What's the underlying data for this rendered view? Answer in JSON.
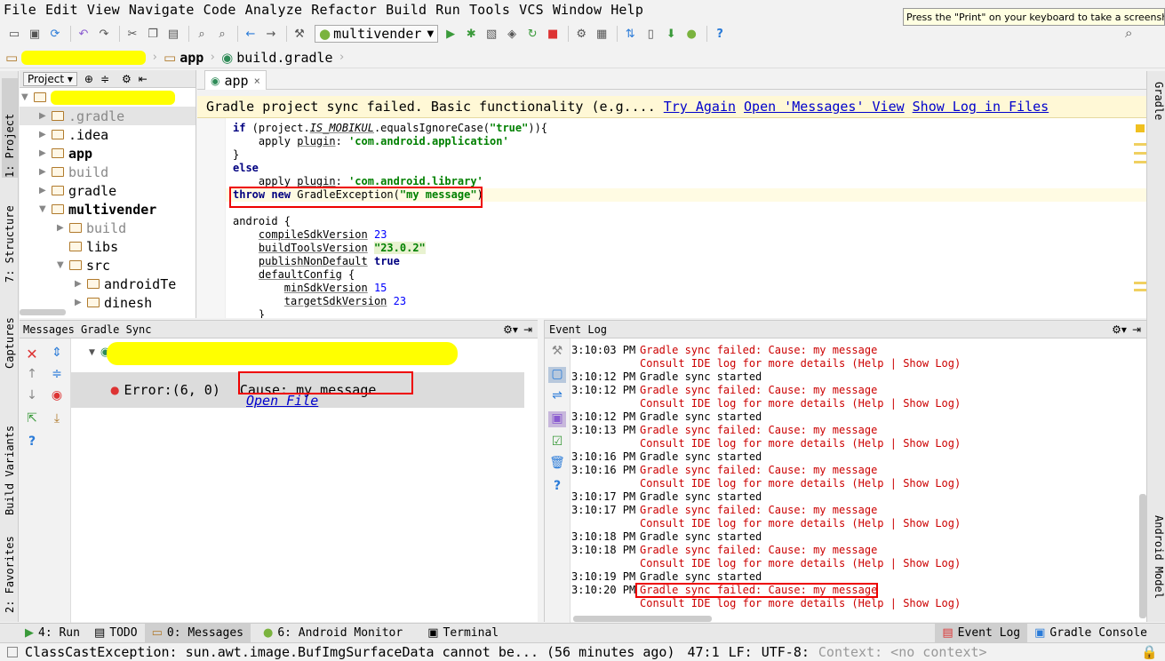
{
  "menubar": {
    "items": [
      "File",
      "Edit",
      "View",
      "Navigate",
      "Code",
      "Analyze",
      "Refactor",
      "Build",
      "Run",
      "Tools",
      "VCS",
      "Window",
      "Help"
    ]
  },
  "tooltip": "Press the \"Print\" on your keyboard to take a screenshot",
  "toolbar": {
    "run_config": "multivender",
    "help": "?"
  },
  "breadcrumb": {
    "module": "app",
    "file": "build.gradle"
  },
  "left_stripe": {
    "tabs": [
      "1: Project",
      "7: Structure",
      "Captures",
      "Build Variants",
      "2: Favorites"
    ]
  },
  "right_stripe": {
    "tabs": [
      "Gradle",
      "Android Model"
    ]
  },
  "project_panel": {
    "header": "Project",
    "tree": [
      {
        "label": ".gradle",
        "dim": true
      },
      {
        "label": ".idea",
        "dim": false
      },
      {
        "label": "app",
        "dim": false,
        "bold": true
      },
      {
        "label": "build",
        "dim": true
      },
      {
        "label": "gradle",
        "dim": false
      },
      {
        "label": "multivender",
        "dim": false,
        "bold": true
      },
      {
        "label": "build",
        "dim": true
      },
      {
        "label": "libs",
        "dim": false
      },
      {
        "label": "src",
        "dim": false
      },
      {
        "label": "androidTe",
        "dim": false
      },
      {
        "label": "dinesh",
        "dim": false
      }
    ]
  },
  "editor": {
    "tab_label": "app",
    "banner_text": "Gradle project sync failed. Basic functionality (e.g....",
    "banner_links": [
      "Try Again",
      "Open 'Messages' View",
      "Show Log in Files"
    ],
    "code": {
      "l1_kw": "if",
      "l1_a": " (project.",
      "l1_prop": "IS_MOBIKUL",
      "l1_b": ".equalsIgnoreCase(",
      "l1_str": "\"true\"",
      "l1_c": ")){",
      "l2_a": "    apply ",
      "l2_prop": "plugin",
      "l2_b": ": ",
      "l2_str": "'com.android.application'",
      "l3": "}",
      "l4_kw": "else",
      "l5_a": "    apply ",
      "l5_prop": "plugin",
      "l5_b": ": ",
      "l5_str": "'com.android.library'",
      "l6_kw1": "throw",
      "l6_kw2": "new",
      "l6_a": " GradleException(",
      "l6_str": "\"my message\"",
      "l6_b": ")",
      "l8": "android {",
      "l9_a": "    ",
      "l9_prop": "compileSdkVersion",
      "l9_num": "23",
      "l10_prop": "buildToolsVersion",
      "l10_str": "\"23.0.2\"",
      "l11_prop": "publishNonDefault",
      "l11_kw": "true",
      "l12_prop": "defaultConfig",
      "l12_b": " {",
      "l13_prop": "minSdkVersion",
      "l13_num": "15",
      "l14_prop": "targetSdkVersion",
      "l14_num": "23",
      "l15": "    }"
    }
  },
  "messages": {
    "header": "Messages Gradle Sync",
    "error_prefix": "Error:(6, 0)",
    "error_text": "Cause: my message",
    "open_file": "Open File"
  },
  "event_log": {
    "header": "Event Log",
    "rows": [
      {
        "time": "3:10:03 PM",
        "text": "Gradle sync failed: Cause: my message",
        "error": true
      },
      {
        "time": "",
        "text": "Consult IDE log for more details (Help | Show Log)",
        "error": true
      },
      {
        "time": "3:10:12 PM",
        "text": "Gradle sync started",
        "error": false
      },
      {
        "time": "3:10:12 PM",
        "text": "Gradle sync failed: Cause: my message",
        "error": true
      },
      {
        "time": "",
        "text": "Consult IDE log for more details (Help | Show Log)",
        "error": true
      },
      {
        "time": "3:10:12 PM",
        "text": "Gradle sync started",
        "error": false
      },
      {
        "time": "3:10:13 PM",
        "text": "Gradle sync failed: Cause: my message",
        "error": true
      },
      {
        "time": "",
        "text": "Consult IDE log for more details (Help | Show Log)",
        "error": true
      },
      {
        "time": "3:10:16 PM",
        "text": "Gradle sync started",
        "error": false
      },
      {
        "time": "3:10:16 PM",
        "text": "Gradle sync failed: Cause: my message",
        "error": true
      },
      {
        "time": "",
        "text": "Consult IDE log for more details (Help | Show Log)",
        "error": true
      },
      {
        "time": "3:10:17 PM",
        "text": "Gradle sync started",
        "error": false
      },
      {
        "time": "3:10:17 PM",
        "text": "Gradle sync failed: Cause: my message",
        "error": true
      },
      {
        "time": "",
        "text": "Consult IDE log for more details (Help | Show Log)",
        "error": true
      },
      {
        "time": "3:10:18 PM",
        "text": "Gradle sync started",
        "error": false
      },
      {
        "time": "3:10:18 PM",
        "text": "Gradle sync failed: Cause: my message",
        "error": true
      },
      {
        "time": "",
        "text": "Consult IDE log for more details (Help | Show Log)",
        "error": true
      },
      {
        "time": "3:10:19 PM",
        "text": "Gradle sync started",
        "error": false
      },
      {
        "time": "3:10:20 PM",
        "text": "Gradle sync failed: Cause: my message",
        "error": true
      },
      {
        "time": "",
        "text": "Consult IDE log for more details (Help | Show Log)",
        "error": true
      }
    ]
  },
  "bottom_tabs": {
    "run": "4: Run",
    "todo": "TODO",
    "messages": "0: Messages",
    "android_monitor": "6: Android Monitor",
    "terminal": "Terminal",
    "event_log": "Event Log",
    "gradle_console": "Gradle Console"
  },
  "statusbar": {
    "message": "ClassCastException: sun.awt.image.BufImgSurfaceData cannot be... (56 minutes ago)",
    "position": "47:1",
    "line_sep": "LF:",
    "encoding": "UTF-8:",
    "context": "Context: <no context>"
  },
  "colors": {
    "error_red": "#cc0000",
    "annotation_red": "#e00000",
    "banner_bg": "#fff8d6",
    "redaction_yellow": "#ffff00"
  }
}
